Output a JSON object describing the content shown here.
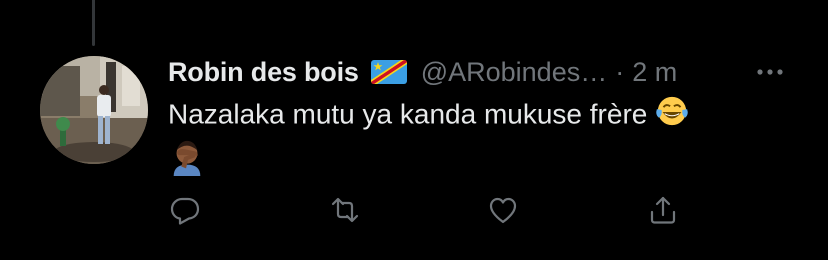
{
  "tweet": {
    "display_name": "Robin des bois",
    "flag": "flag-dr-congo-icon",
    "handle": "@ARobindes…",
    "separator": "·",
    "time": "2 m",
    "text": "Nazalaka mutu ya kanda mukuse frère",
    "emojis": [
      "face-with-tears-of-joy-icon",
      "person-facepalming-icon"
    ]
  },
  "actions": {
    "reply": "reply-icon",
    "retweet": "retweet-icon",
    "like": "like-icon",
    "share": "share-icon",
    "more": "more-icon"
  },
  "colors": {
    "background": "#000000",
    "primary_text": "#e7e9ea",
    "secondary_text": "#71767b",
    "thread_line": "#333639"
  }
}
